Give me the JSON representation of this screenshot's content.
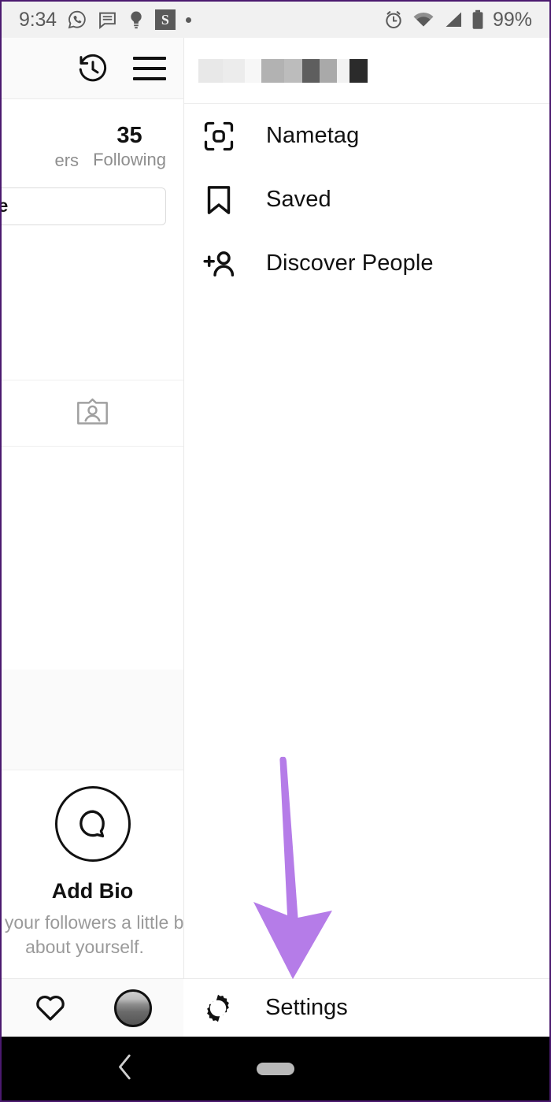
{
  "status_bar": {
    "time": "9:34",
    "battery_percent": "99%",
    "left_icons": [
      "whatsapp-icon",
      "sms-message-icon",
      "lightbulb-icon",
      "s-app-badge",
      "dot-indicator"
    ],
    "s_badge_letter": "S",
    "right_icons": [
      "alarm-clock-icon",
      "wifi-icon",
      "cellular-signal-icon",
      "battery-icon"
    ],
    "background_color": "#f1f1f1",
    "text_color": "#5a5a5a"
  },
  "left_panel": {
    "topbar_icons": [
      "archive-history-icon",
      "hamburger-menu-icon"
    ],
    "stats": [
      {
        "label_partial": "ers",
        "full_label": "Followers"
      },
      {
        "count": "35",
        "label": "Following"
      }
    ],
    "edit_profile_button_partial": "ofile",
    "edit_profile_button_full": "Edit Profile",
    "nametag_icon": "nametag-card-icon",
    "add_bio": {
      "title": "Add Bio",
      "subtitle_line1": "ell your followers a little bi",
      "subtitle_line2": "about yourself.",
      "icon": "speech-bubble-circle-icon"
    },
    "tabbar_icons": [
      "heart-activity-icon",
      "profile-avatar-icon"
    ]
  },
  "side_menu": {
    "username_blurred": true,
    "username_blur_blocks": [
      "#e8e8e8",
      "#ececec",
      "#f7f7f7",
      "#b2b2b2",
      "#bcbcbc",
      "#5e5e5e",
      "#a9a9a9",
      "#f2f2f2",
      "#2b2b2b"
    ],
    "items": [
      {
        "id": "nametag",
        "label": "Nametag",
        "icon": "nametag-scan-icon"
      },
      {
        "id": "saved",
        "label": "Saved",
        "icon": "bookmark-icon"
      },
      {
        "id": "discover-people",
        "label": "Discover People",
        "icon": "add-person-icon"
      }
    ],
    "footer": {
      "label": "Settings",
      "icon": "gear-settings-icon"
    }
  },
  "annotation": {
    "type": "down-arrow",
    "color": "#b57ce8",
    "points_to": "Settings"
  },
  "nav_bar": {
    "background_color": "#000000",
    "buttons": [
      "back-chevron-icon",
      "home-pill-icon"
    ]
  }
}
